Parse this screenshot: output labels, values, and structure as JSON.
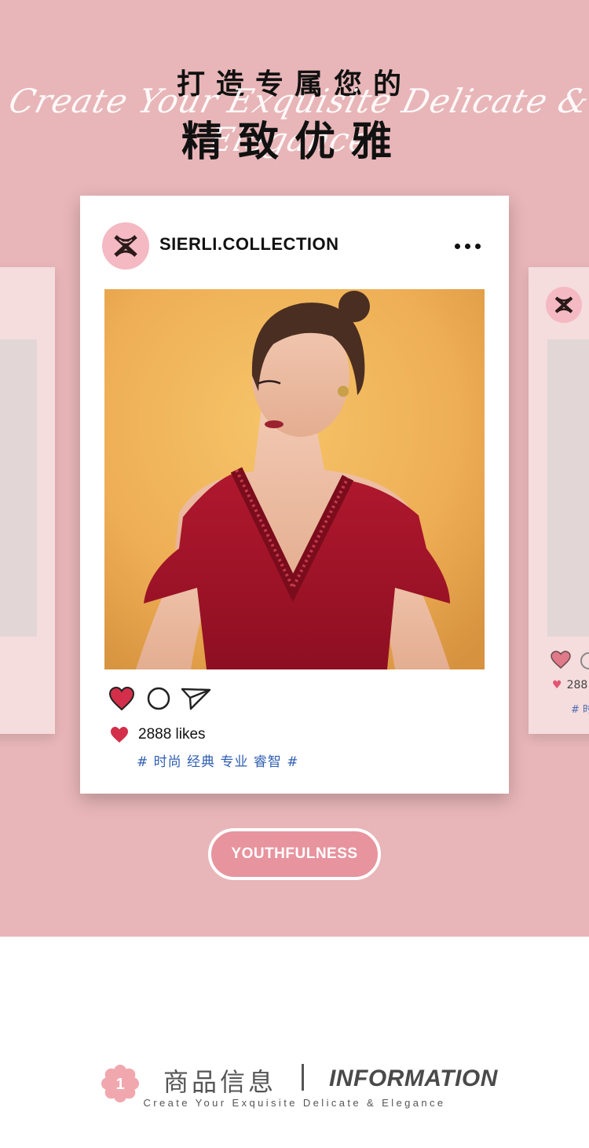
{
  "hero": {
    "title_top": "打造专属您的",
    "title_main": "精致优雅",
    "script_text": "Create Your Exquisite Delicate & Elegance",
    "background_color": "#e8b6b8"
  },
  "post": {
    "account_name": "SIERLI.COLLECTION",
    "avatar_icon": "sierli-monogram-logo",
    "more_icon": "more-dots-icon",
    "photo_description_icon": "model-in-red-dress-photo",
    "actions": {
      "like_icon": "heart-icon",
      "comment_icon": "comment-circle-icon",
      "share_icon": "send-icon"
    },
    "likes_text": "2888 likes",
    "tags_text": "# 时尚 经典 专业 睿智 #",
    "accent_color": "#d32f4a",
    "tag_color": "#2f5fb0"
  },
  "side_card_right": {
    "likes_partial": "288",
    "tag_partial": "# 时"
  },
  "pill_button": {
    "label": "YOUTHFULNESS",
    "color": "#e7949e"
  },
  "info_header": {
    "number": "1",
    "title_cn": "商品信息",
    "title_en": "INFORMATION",
    "subtitle": "Create Your Exquisite Delicate & Elegance"
  }
}
